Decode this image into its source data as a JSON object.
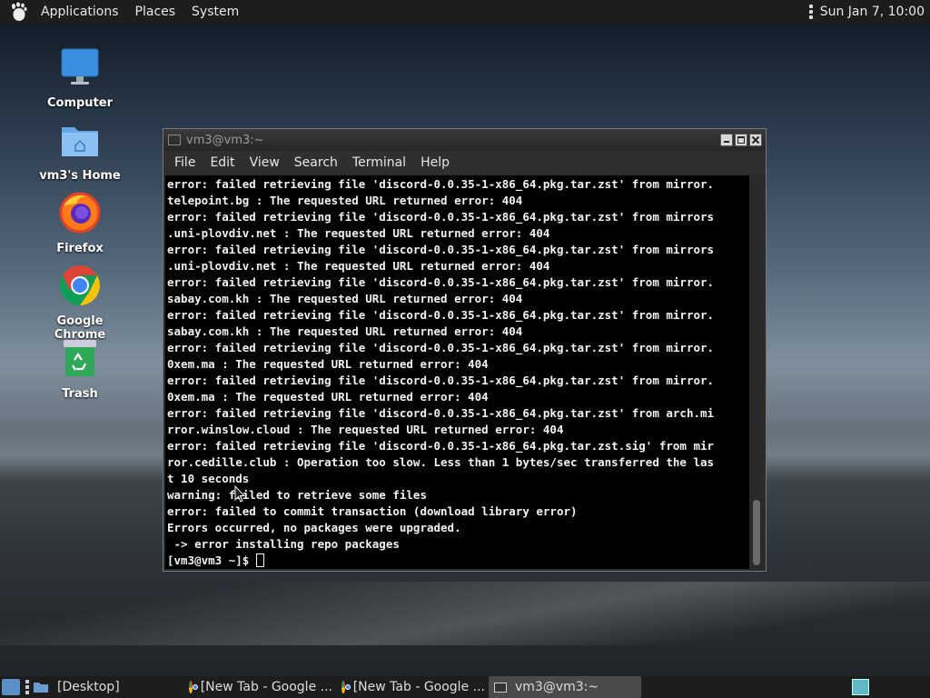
{
  "top_panel": {
    "menus": [
      "Applications",
      "Places",
      "System"
    ],
    "clock": "Sun Jan  7, 10:00"
  },
  "desktop_icons": [
    {
      "label": "Computer",
      "icon": "computer-icon"
    },
    {
      "label": "vm3's Home",
      "icon": "home-folder-icon"
    },
    {
      "label": "Firefox",
      "icon": "firefox-icon"
    },
    {
      "label": "Google Chrome",
      "icon": "chrome-icon"
    },
    {
      "label": "Trash",
      "icon": "trash-icon"
    }
  ],
  "terminal": {
    "title": "vm3@vm3:~",
    "menus": [
      "File",
      "Edit",
      "View",
      "Search",
      "Terminal",
      "Help"
    ],
    "lines": [
      "error: failed retrieving file 'discord-0.0.35-1-x86_64.pkg.tar.zst' from mirror.",
      "telepoint.bg : The requested URL returned error: 404",
      "error: failed retrieving file 'discord-0.0.35-1-x86_64.pkg.tar.zst' from mirrors",
      ".uni-plovdiv.net : The requested URL returned error: 404",
      "error: failed retrieving file 'discord-0.0.35-1-x86_64.pkg.tar.zst' from mirrors",
      ".uni-plovdiv.net : The requested URL returned error: 404",
      "error: failed retrieving file 'discord-0.0.35-1-x86_64.pkg.tar.zst' from mirror.",
      "sabay.com.kh : The requested URL returned error: 404",
      "error: failed retrieving file 'discord-0.0.35-1-x86_64.pkg.tar.zst' from mirror.",
      "sabay.com.kh : The requested URL returned error: 404",
      "error: failed retrieving file 'discord-0.0.35-1-x86_64.pkg.tar.zst' from mirror.",
      "0xem.ma : The requested URL returned error: 404",
      "error: failed retrieving file 'discord-0.0.35-1-x86_64.pkg.tar.zst' from mirror.",
      "0xem.ma : The requested URL returned error: 404",
      "error: failed retrieving file 'discord-0.0.35-1-x86_64.pkg.tar.zst' from arch.mi",
      "rror.winslow.cloud : The requested URL returned error: 404",
      "error: failed retrieving file 'discord-0.0.35-1-x86_64.pkg.tar.zst.sig' from mir",
      "ror.cedille.club : Operation too slow. Less than 1 bytes/sec transferred the las",
      "t 10 seconds",
      "warning: failed to retrieve some files",
      "error: failed to commit transaction (download library error)",
      "Errors occurred, no packages were upgraded.",
      " -> error installing repo packages"
    ],
    "prompt": "[vm3@vm3 ~]$ "
  },
  "taskbar": {
    "items": [
      {
        "label": "[Desktop]",
        "icon": "folder-icon"
      },
      {
        "label": "[New Tab - Google ...",
        "icon": "chrome-icon"
      },
      {
        "label": "[New Tab - Google ...",
        "icon": "chrome-icon"
      },
      {
        "label": "vm3@vm3:~",
        "icon": "terminal-icon",
        "active": true
      }
    ]
  }
}
